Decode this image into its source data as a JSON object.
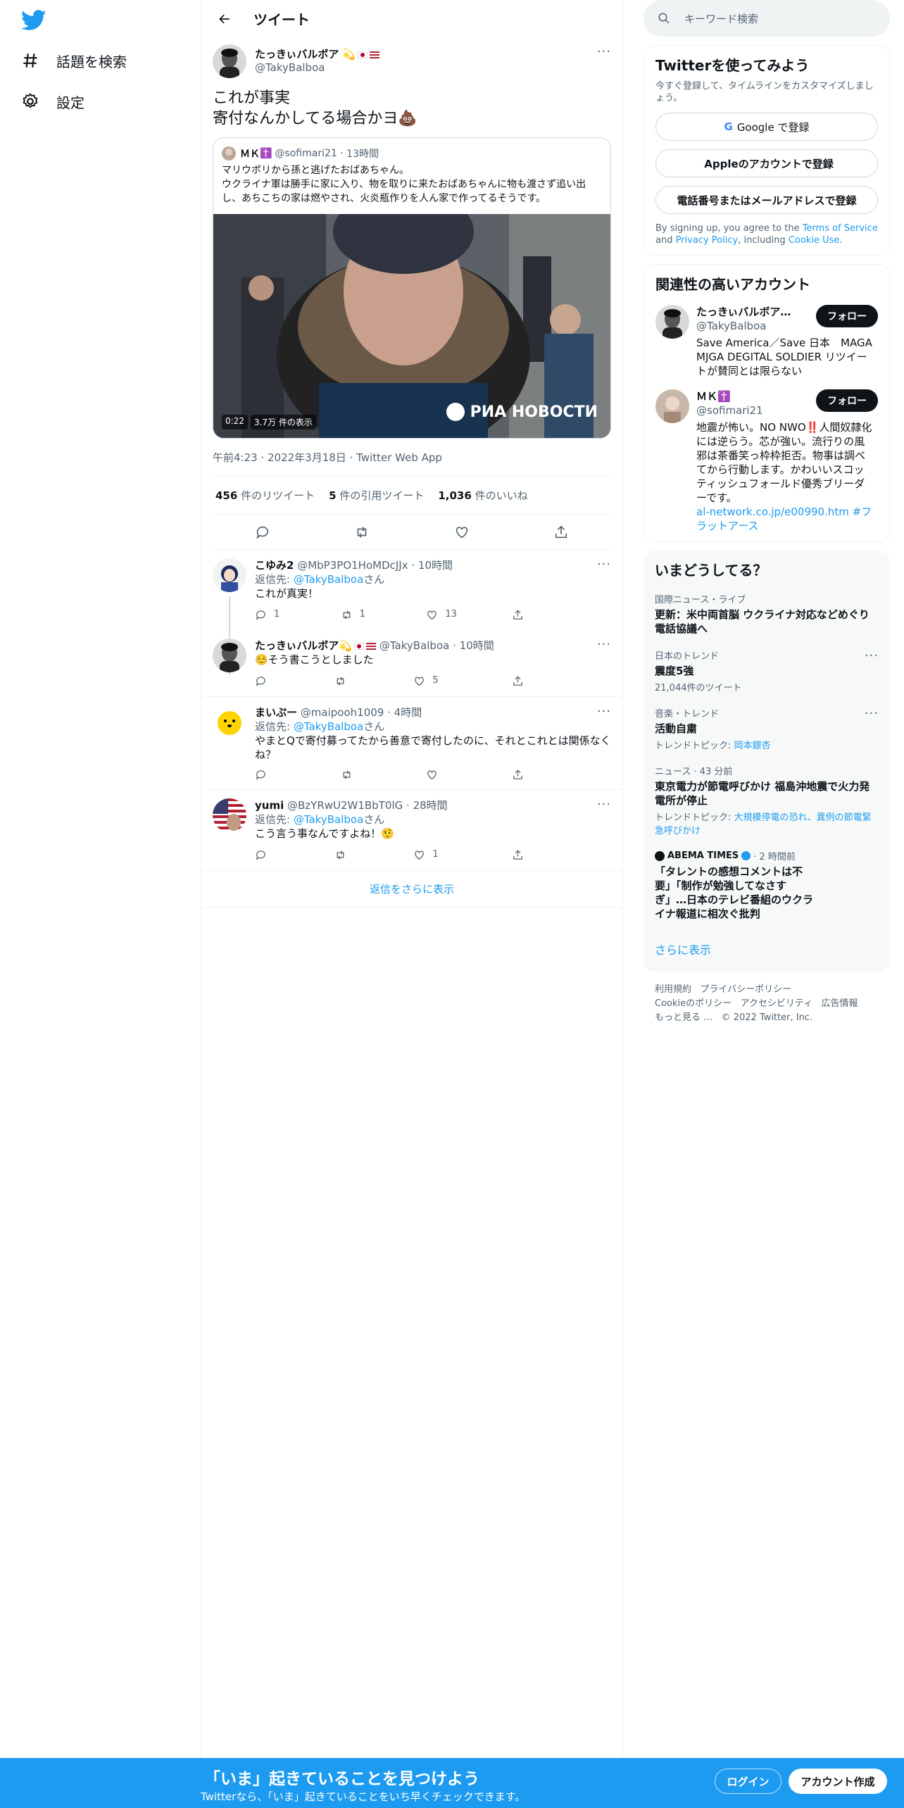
{
  "nav": {
    "explore": "話題を検索",
    "settings": "設定"
  },
  "header": {
    "title": "ツイート"
  },
  "tweet": {
    "author_name": "たっきぃバルボア",
    "author_handle": "@TakyBalboa",
    "text_line1": "これが事実",
    "text_line2": "寄付なんかしてる場合かヨ",
    "quote": {
      "name": "ＭＫ",
      "handle": "@sofimari21",
      "time": "13時間",
      "line1": "マリウポリから孫と逃げたおばあちゃん。",
      "line2": "ウクライナ軍は勝手に家に入り、物を取りに来たおばあちゃんに物も渡さず追い出し、あちこちの家は燃やされ、火炎瓶作りを人ん家で作ってるそうです。",
      "video_time": "0:22",
      "video_views": "3.7万 件の表示",
      "watermark": "РИА НОВОСТИ"
    },
    "meta": "午前4:23 · 2022年3月18日 · Twitter Web App",
    "stats": {
      "retweets_num": "456",
      "retweets_label": "件のリツイート",
      "quotes_num": "5",
      "quotes_label": "件の引用ツイート",
      "likes_num": "1,036",
      "likes_label": "件のいいね"
    }
  },
  "replies": [
    {
      "name": "こゆみ2",
      "handle": "@MbP3PO1HoMDcJJx",
      "time": "· 10時間",
      "replying": "返信先: ",
      "replying_to": "@TakyBalboa",
      "replying_suffix": "さん",
      "text": "これが真実！",
      "replies": "1",
      "retweets": "1",
      "likes": "13"
    },
    {
      "name": "たっきぃバルボア",
      "handle": "@TakyBalboa",
      "time": "· 10時間",
      "text": "☺️そう書こうとしました",
      "likes": "5"
    },
    {
      "name": "まいぷー",
      "handle": "@maipooh1009",
      "time": "· 4時間",
      "replying": "返信先: ",
      "replying_to": "@TakyBalboa",
      "replying_suffix": "さん",
      "text": "やまとQで寄付募ってたから善意で寄付したのに、それとこれとは関係なくね？"
    },
    {
      "name": "yumi",
      "handle": "@BzYRwU2W1BbT0lG",
      "time": "· 28時間",
      "replying": "返信先: ",
      "replying_to": "@TakyBalboa",
      "replying_suffix": "さん",
      "text": "こう言う事なんですよね！🤨",
      "likes": "1"
    }
  ],
  "show_more_replies": "返信をさらに表示",
  "search": {
    "placeholder": "キーワード検索"
  },
  "signup_card": {
    "title": "Twitterを使ってみよう",
    "subtitle": "今すぐ登録して、タイムラインをカスタマイズしましょう。",
    "google": "Google で登録",
    "apple": "Appleのアカウントで登録",
    "phone": "電話番号またはメールアドレスで登録",
    "legal_1": "By signing up, you agree to the ",
    "terms": "Terms of Service",
    "legal_2": " and ",
    "privacy": "Privacy Policy",
    "legal_3": ", including ",
    "cookie": "Cookie Use",
    "legal_4": "."
  },
  "related": {
    "title": "関連性の高いアカウント",
    "follow_label": "フォロー",
    "accounts": [
      {
        "name": "たっきぃバルボア…",
        "handle": "@TakyBalboa",
        "bio": "Save America／Save 日本　MAGA MJGA DEGITAL SOLDIER リツイートが賛同とは限らない"
      },
      {
        "name": "ＭＫ",
        "handle": "@sofimari21",
        "bio": "地震が怖い。NO NWO‼️人間奴隷化には逆らう。芯が強い。流行りの風邪は茶番笑っ枠枠拒否。物事は調べてから行動します。かわいいスコッティッシュフォールド優秀ブリーダーです。",
        "bio_link": "al-network.co.jp/e00990.htm #フラットアース"
      }
    ]
  },
  "trends": {
    "title": "いまどうしてる？",
    "items": [
      {
        "category": "国際ニュース・ライブ",
        "title": "更新：米中両首脳 ウクライナ対応などめぐり電話協議へ"
      },
      {
        "category": "日本のトレンド",
        "title": "震度5強",
        "sub": "21,044件のツイート"
      },
      {
        "category": "音楽・トレンド",
        "title": "活動自粛",
        "sub": "トレンドトピック: ",
        "sub_link": "岡本銀杏"
      },
      {
        "category": "ニュース · 43 分前",
        "title": "東京電力が節電呼びかけ 福島沖地震で火力発電所が停止",
        "sub": "トレンドトピック: ",
        "sub_link": "大規模停電の恐れ、異例の節電緊急呼びかけ"
      },
      {
        "category": "ABEMA TIMES",
        "category_time": "· 2 時間前",
        "title": "「タレントの感想コメントは不要」「制作が勉強してなさすぎ」…日本のテレビ番組のウクライナ報道に相次ぐ批判"
      }
    ],
    "show_more": "さらに表示"
  },
  "footer": {
    "terms": "利用規約",
    "privacy": "プライバシーポリシー",
    "cookie": "Cookieのポリシー",
    "accessibility": "アクセシビリティ",
    "ads": "広告情報",
    "more": "もっと見る …",
    "copyright": "© 2022 Twitter, Inc."
  },
  "bottom_bar": {
    "title": "「いま」起きていることを見つけよう",
    "subtitle": "Twitterなら、「いま」起きていることをいち早くチェックできます。",
    "login": "ログイン",
    "signup": "アカウント作成"
  },
  "colors": {
    "accent": "#1d9bf0",
    "text": "#0f1419",
    "muted": "#536471",
    "border": "#eff3f4"
  }
}
